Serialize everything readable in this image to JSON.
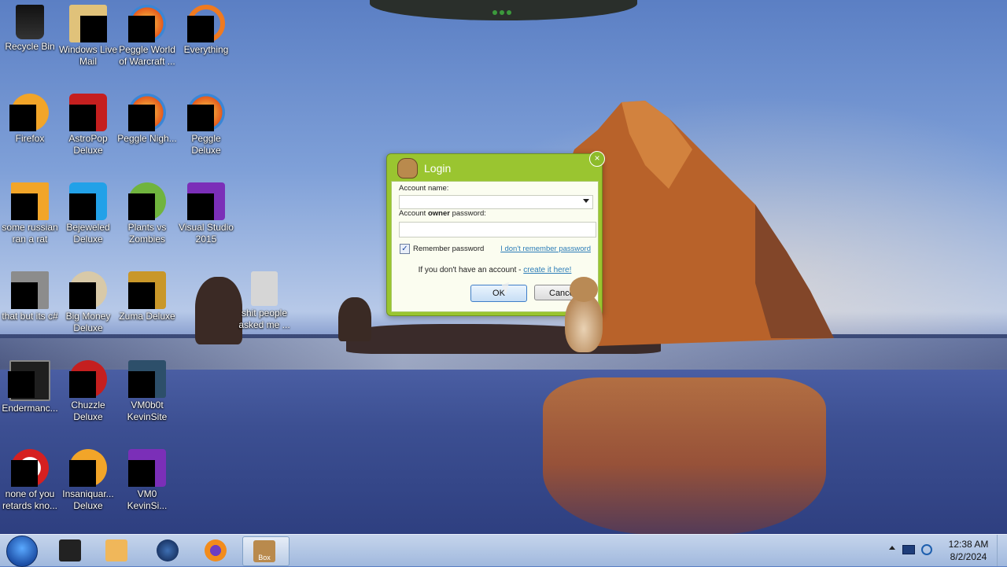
{
  "desktop": {
    "icons": [
      {
        "label": "Recycle Bin",
        "icon": "recycle-bin-icon"
      },
      {
        "label": "Windows Live Mail",
        "icon": "mail-icon"
      },
      {
        "label": "Peggle World of Warcraft ...",
        "icon": "peggle-icon"
      },
      {
        "label": "Everything",
        "icon": "search-icon"
      },
      {
        "label": "Firefox",
        "icon": "firefox-icon"
      },
      {
        "label": "AstroPop Deluxe",
        "icon": "game-icon"
      },
      {
        "label": "Peggle Nigh...",
        "icon": "peggle-icon"
      },
      {
        "label": "Peggle Deluxe",
        "icon": "peggle-icon"
      },
      {
        "label": "some russian ran a rat",
        "icon": "file-icon"
      },
      {
        "label": "Bejeweled Deluxe",
        "icon": "gem-icon"
      },
      {
        "label": "Plants vs Zombies",
        "icon": "plant-icon"
      },
      {
        "label": "Visual Studio 2015",
        "icon": "visual-studio-icon"
      },
      {
        "label": "that but its c#",
        "icon": "file-icon"
      },
      {
        "label": "Big Money Deluxe",
        "icon": "money-bag-icon"
      },
      {
        "label": "Zuma Deluxe",
        "icon": "zuma-icon"
      },
      {
        "label": "shit people asked me ...",
        "icon": "folder-icon"
      },
      {
        "label": "Endermanc...",
        "icon": "terminal-icon"
      },
      {
        "label": "Chuzzle Deluxe",
        "icon": "chuzzle-icon"
      },
      {
        "label": "VM0b0t KevinSite",
        "icon": "shortcut-icon"
      },
      {
        "label": "none of you retards kno...",
        "icon": "file-icon"
      },
      {
        "label": "Insaniquar... Deluxe",
        "icon": "fish-icon"
      },
      {
        "label": "VM0 KevinSi...",
        "icon": "shortcut-icon"
      }
    ]
  },
  "login": {
    "title": "Login",
    "close_glyph": "×",
    "account_name_label": "Account name:",
    "password_label_prefix": "Account ",
    "password_label_bold": "owner",
    "password_label_suffix": " password:",
    "account_value": "",
    "password_value": "",
    "remember_checked_glyph": "✓",
    "remember_label": "Remember password",
    "forgot_link": "I don't remember password",
    "signup_prefix": "If you don't have an account - ",
    "signup_link": "create it here!",
    "ok_label": "OK",
    "cancel_label": "Cancel"
  },
  "taskbar": {
    "items": [
      {
        "icon": "media-icon"
      },
      {
        "icon": "media-player-icon"
      },
      {
        "icon": "globe-icon"
      },
      {
        "icon": "firefox-icon"
      },
      {
        "icon": "box-app-icon",
        "active": true,
        "label": "Box"
      }
    ],
    "clock_time": "12:38 AM",
    "clock_date": "8/2/2024"
  },
  "colors": {
    "dialog_frame": "#9ac530",
    "link": "#2c7db8"
  }
}
